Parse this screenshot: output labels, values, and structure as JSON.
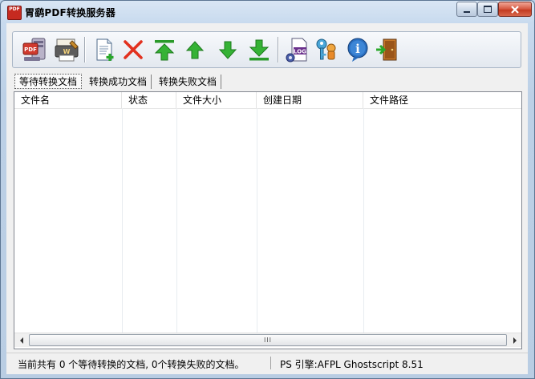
{
  "window": {
    "title": "胃鹞PDF转换服务器",
    "app_icon_text": "PDF"
  },
  "caption_buttons": [
    "minimize",
    "maximize",
    "close"
  ],
  "toolbar": {
    "buttons": [
      {
        "name": "pdf-server-icon",
        "label": "PDF"
      },
      {
        "name": "printer-settings-icon",
        "label": "W"
      },
      {
        "name": "add-document-icon"
      },
      {
        "name": "delete-icon"
      },
      {
        "name": "move-top-icon"
      },
      {
        "name": "move-up-icon"
      },
      {
        "name": "move-down-icon"
      },
      {
        "name": "move-bottom-icon"
      },
      {
        "name": "log-icon",
        "label": "LOG"
      },
      {
        "name": "key-icon"
      },
      {
        "name": "info-icon",
        "label": "i"
      },
      {
        "name": "exit-icon"
      }
    ]
  },
  "tabs": [
    {
      "label": "等待转换文档",
      "active": true
    },
    {
      "label": "转换成功文档",
      "active": false
    },
    {
      "label": "转换失败文档",
      "active": false
    }
  ],
  "list": {
    "columns": [
      "文件名",
      "状态",
      "文件大小",
      "创建日期",
      "文件路径"
    ],
    "rows": []
  },
  "scrollbar": {
    "thumb_grip": "III"
  },
  "status": {
    "left": "当前共有 0 个等待转换的文档, 0个转换失败的文档。",
    "right": "PS 引擎:AFPL Ghostscript 8.51"
  }
}
